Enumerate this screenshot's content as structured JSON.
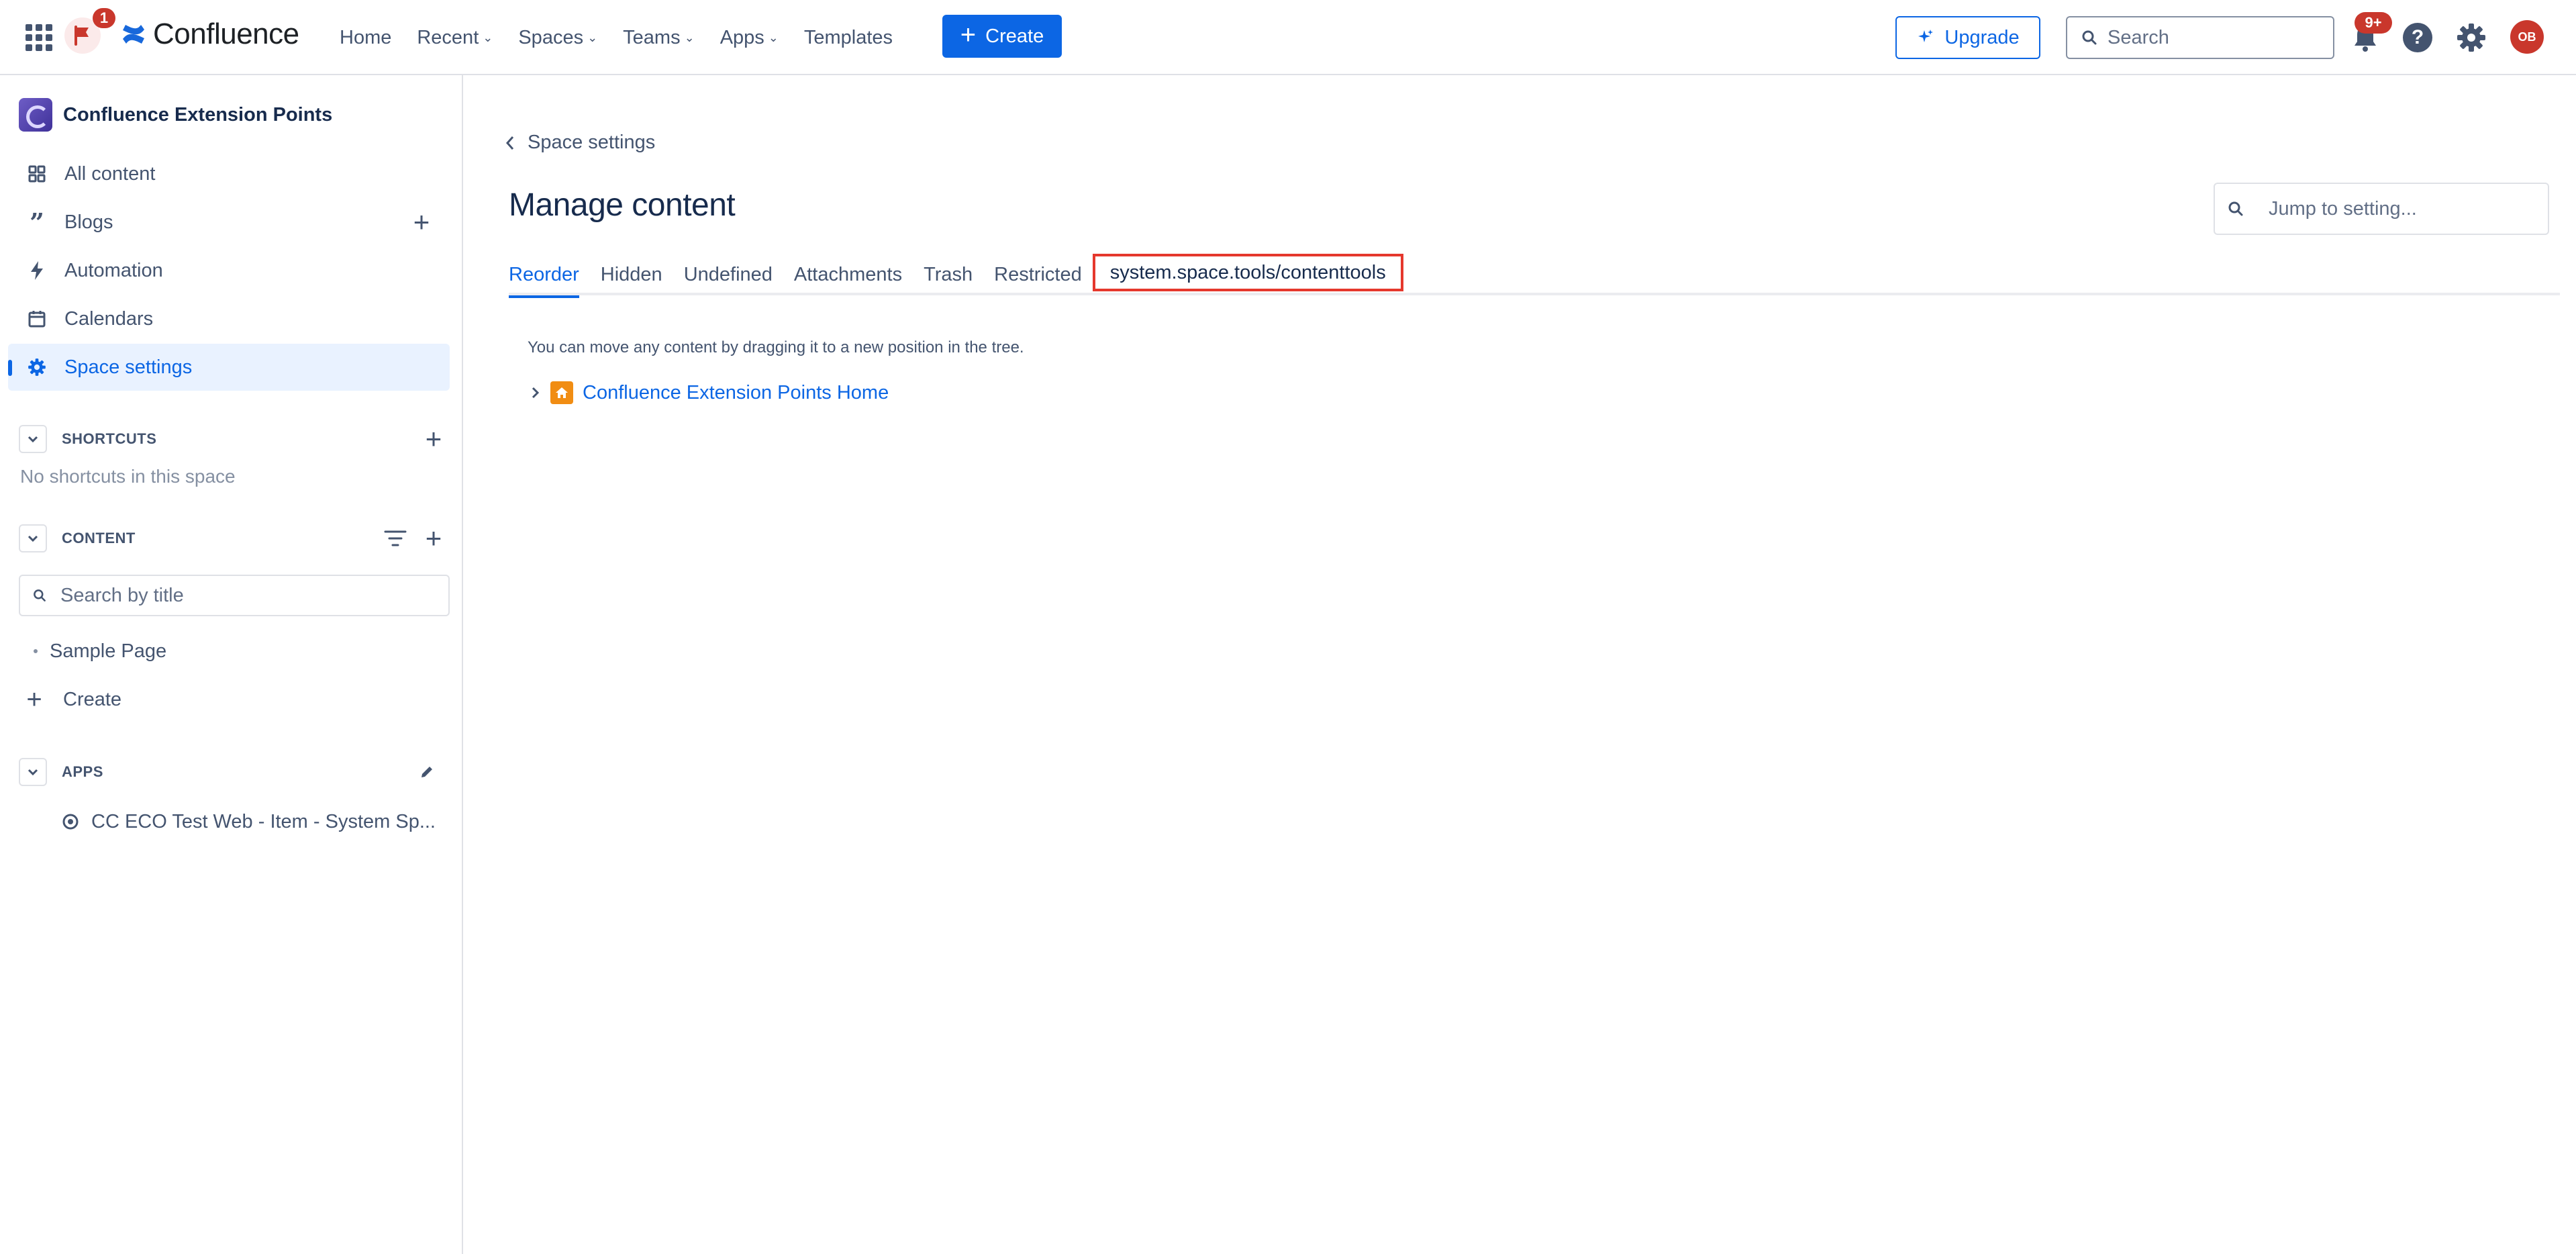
{
  "topbar": {
    "flag_count": "1",
    "product_name": "Confluence",
    "nav": [
      {
        "label": "Home",
        "has_dropdown": false
      },
      {
        "label": "Recent",
        "has_dropdown": true
      },
      {
        "label": "Spaces",
        "has_dropdown": true
      },
      {
        "label": "Teams",
        "has_dropdown": true
      },
      {
        "label": "Apps",
        "has_dropdown": true
      },
      {
        "label": "Templates",
        "has_dropdown": false
      }
    ],
    "create_label": "Create",
    "upgrade_label": "Upgrade",
    "search_placeholder": "Search",
    "notifications_count": "9+",
    "avatar_initials": "OB",
    "accent_color": "#0c66e4",
    "alert_color": "#c9372c"
  },
  "sidebar": {
    "space_name": "Confluence Extension Points",
    "items": [
      {
        "label": "All content",
        "icon": "grid-icon"
      },
      {
        "label": "Blogs",
        "icon": "quote-icon"
      },
      {
        "label": "Automation",
        "icon": "lightning-icon"
      },
      {
        "label": "Calendars",
        "icon": "calendar-icon"
      },
      {
        "label": "Space settings",
        "icon": "gear-icon",
        "active": true
      }
    ],
    "shortcuts": {
      "title": "SHORTCUTS",
      "empty_text": "No shortcuts in this space"
    },
    "content": {
      "title": "CONTENT",
      "search_placeholder": "Search by title",
      "pages": [
        "Sample Page"
      ],
      "create_label": "Create"
    },
    "apps": {
      "title": "APPS",
      "items": [
        "CC ECO Test Web - Item - System Sp..."
      ]
    }
  },
  "main": {
    "back_label": "Space settings",
    "title": "Manage content",
    "jump_placeholder": "Jump to setting...",
    "tabs": [
      {
        "label": "Reorder",
        "active": true
      },
      {
        "label": "Hidden"
      },
      {
        "label": "Undefined"
      },
      {
        "label": "Attachments"
      },
      {
        "label": "Trash"
      },
      {
        "label": "Restricted"
      },
      {
        "label": "system.space.tools/contenttools",
        "highlighted": true
      }
    ],
    "hint": "You can move any content by dragging it to a new position in the tree.",
    "tree_root": "Confluence Extension Points Home"
  }
}
